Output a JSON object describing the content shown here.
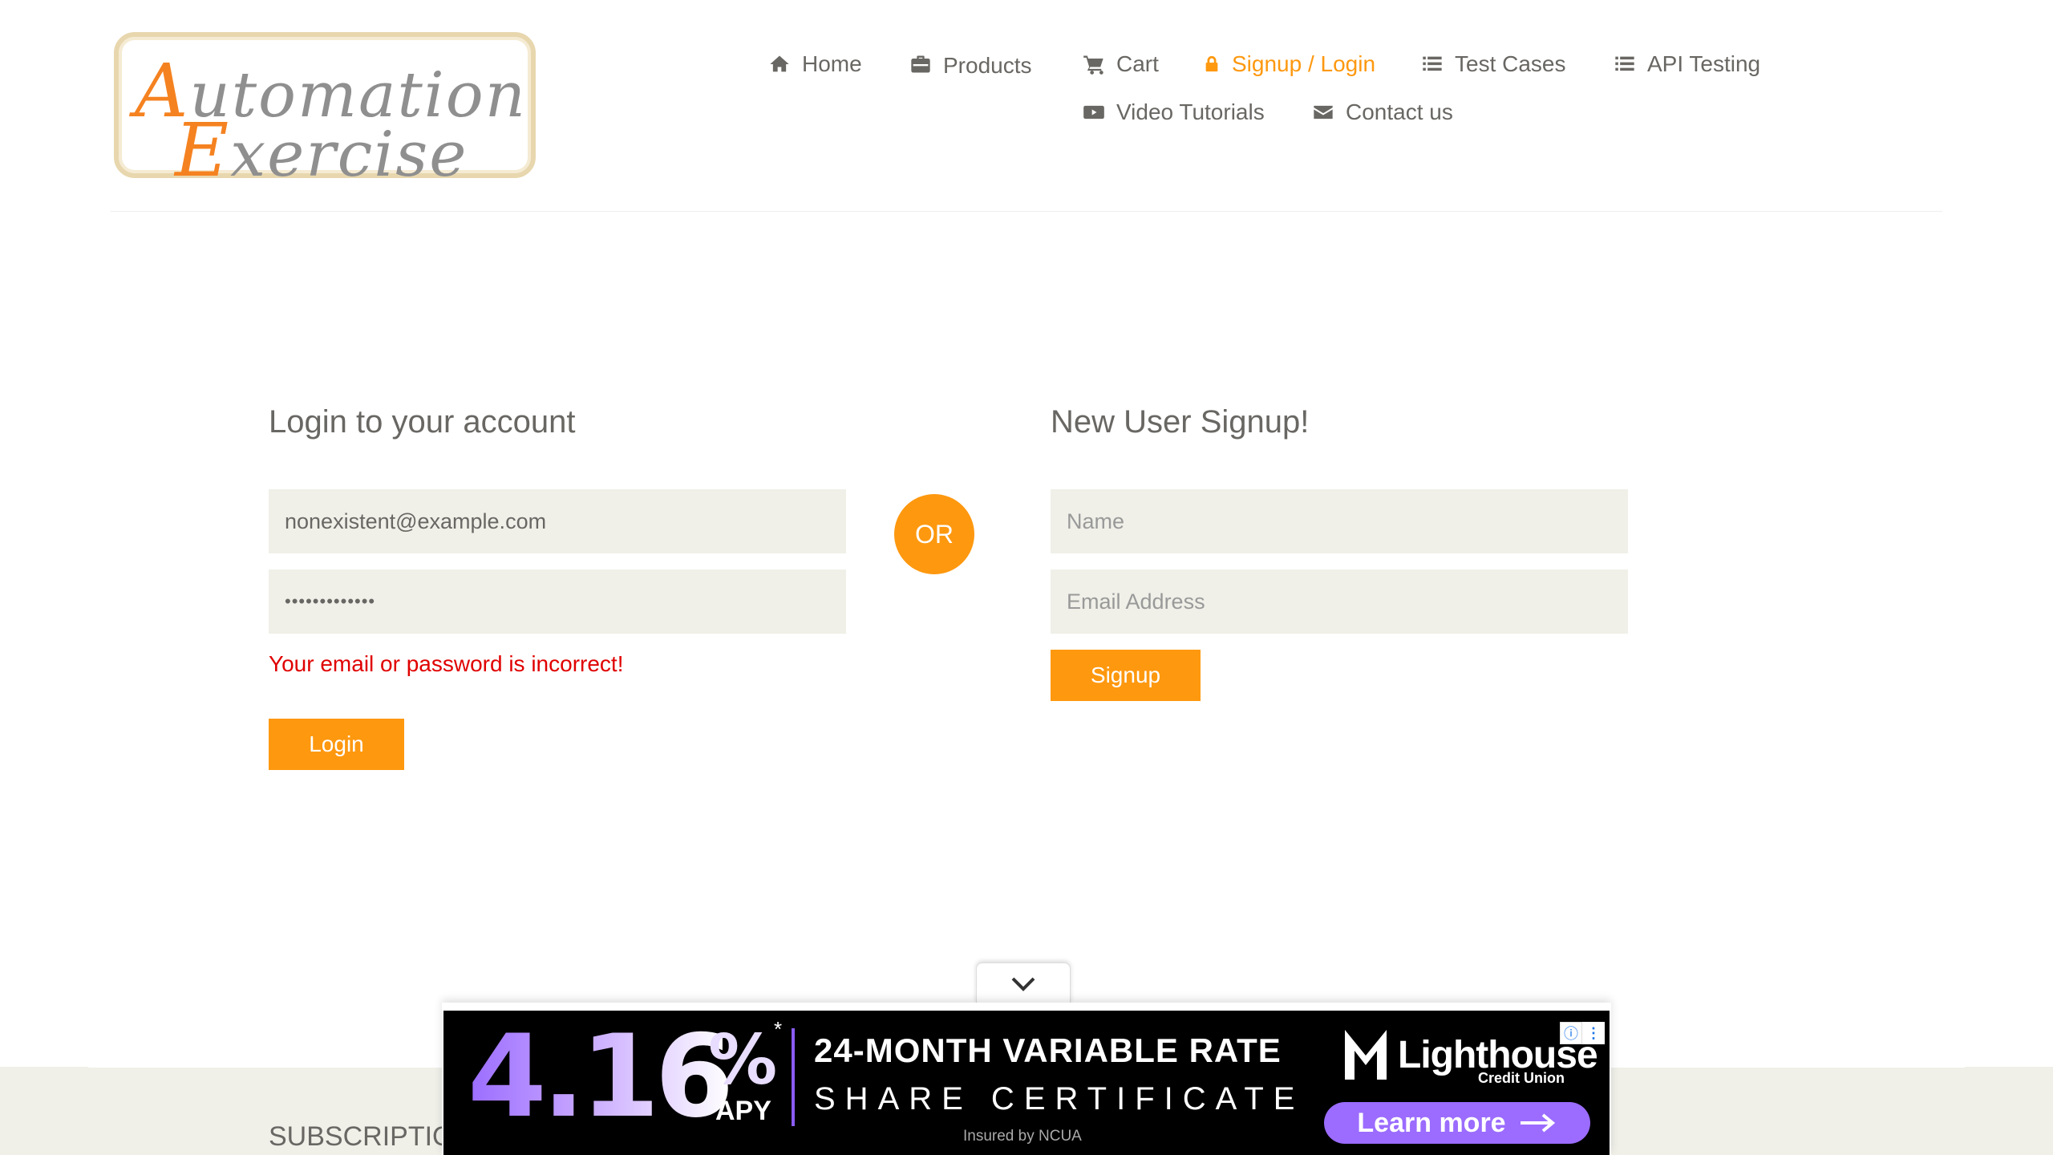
{
  "logo": {
    "line1_cap": "A",
    "line1_rest": "utomation",
    "line2_cap": "E",
    "line2_rest": "xercise"
  },
  "nav": {
    "home": "Home",
    "products": "Products",
    "cart": "Cart",
    "signup_login": "Signup / Login",
    "test_cases": "Test Cases",
    "api_testing": "API Testing",
    "video_tutorials": "Video Tutorials",
    "contact_us": "Contact us",
    "active": "Signup / Login"
  },
  "login": {
    "title": "Login to your account",
    "email_value": "nonexistent@example.com",
    "password_value": "•••••••••••••",
    "error": "Your email or password is incorrect!",
    "button": "Login"
  },
  "or_label": "OR",
  "signup": {
    "title": "New User Signup!",
    "name_placeholder": "Name",
    "email_placeholder": "Email Address",
    "button": "Signup"
  },
  "footer": {
    "subscription": "SUBSCRIPTIO"
  },
  "ad": {
    "rate": "4.16",
    "percent": "%",
    "asterisk": "*",
    "apy": "APY",
    "line1": "24-MONTH VARIABLE RATE",
    "line2": "SHARE CERTIFICATE",
    "line3": "Insured by NCUA",
    "brand": "Lighthouse",
    "brand_sub": "Credit Union",
    "cta": "Learn more",
    "info_icon": "info-icon",
    "menu_icon": "vertical-dots-icon"
  },
  "colors": {
    "accent": "#fe980f",
    "input_bg": "#f0f0e9",
    "error": "#e00000",
    "text": "#696763"
  }
}
